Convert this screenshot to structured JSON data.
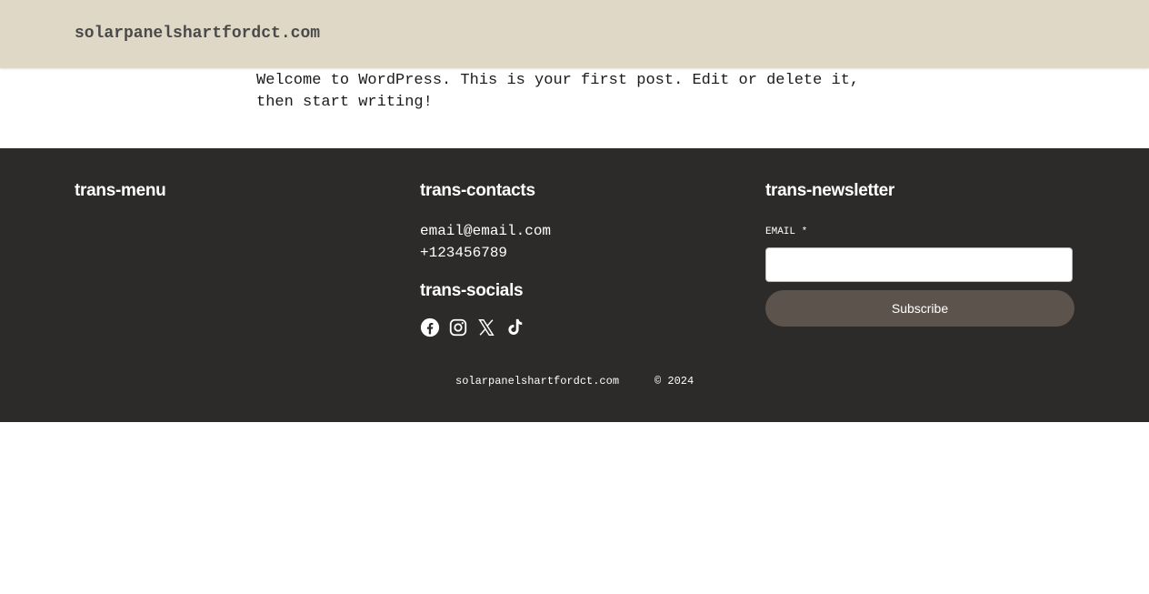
{
  "header": {
    "site_title": "solarpanelshartfordct.com"
  },
  "post": {
    "text": "Welcome to WordPress. This is your first post. Edit or delete it, then start writing!"
  },
  "footer": {
    "menu_heading": "trans-menu",
    "contacts_heading": "trans-contacts",
    "email": "email@email.com",
    "phone": "+123456789",
    "socials_heading": "trans-socials",
    "socials": [
      "facebook-icon",
      "instagram-icon",
      "x-icon",
      "tiktok-icon"
    ],
    "newsletter_heading": "trans-newsletter",
    "email_label": "EMAIL *",
    "email_placeholder": "",
    "subscribe_label": "Subscribe",
    "site_link": "solarpanelshartfordct.com",
    "copyright": "© 2024"
  },
  "colors": {
    "header_bg": "#e0d8c7",
    "footer_bg": "#2d2b29",
    "button_bg": "#5c534c"
  }
}
